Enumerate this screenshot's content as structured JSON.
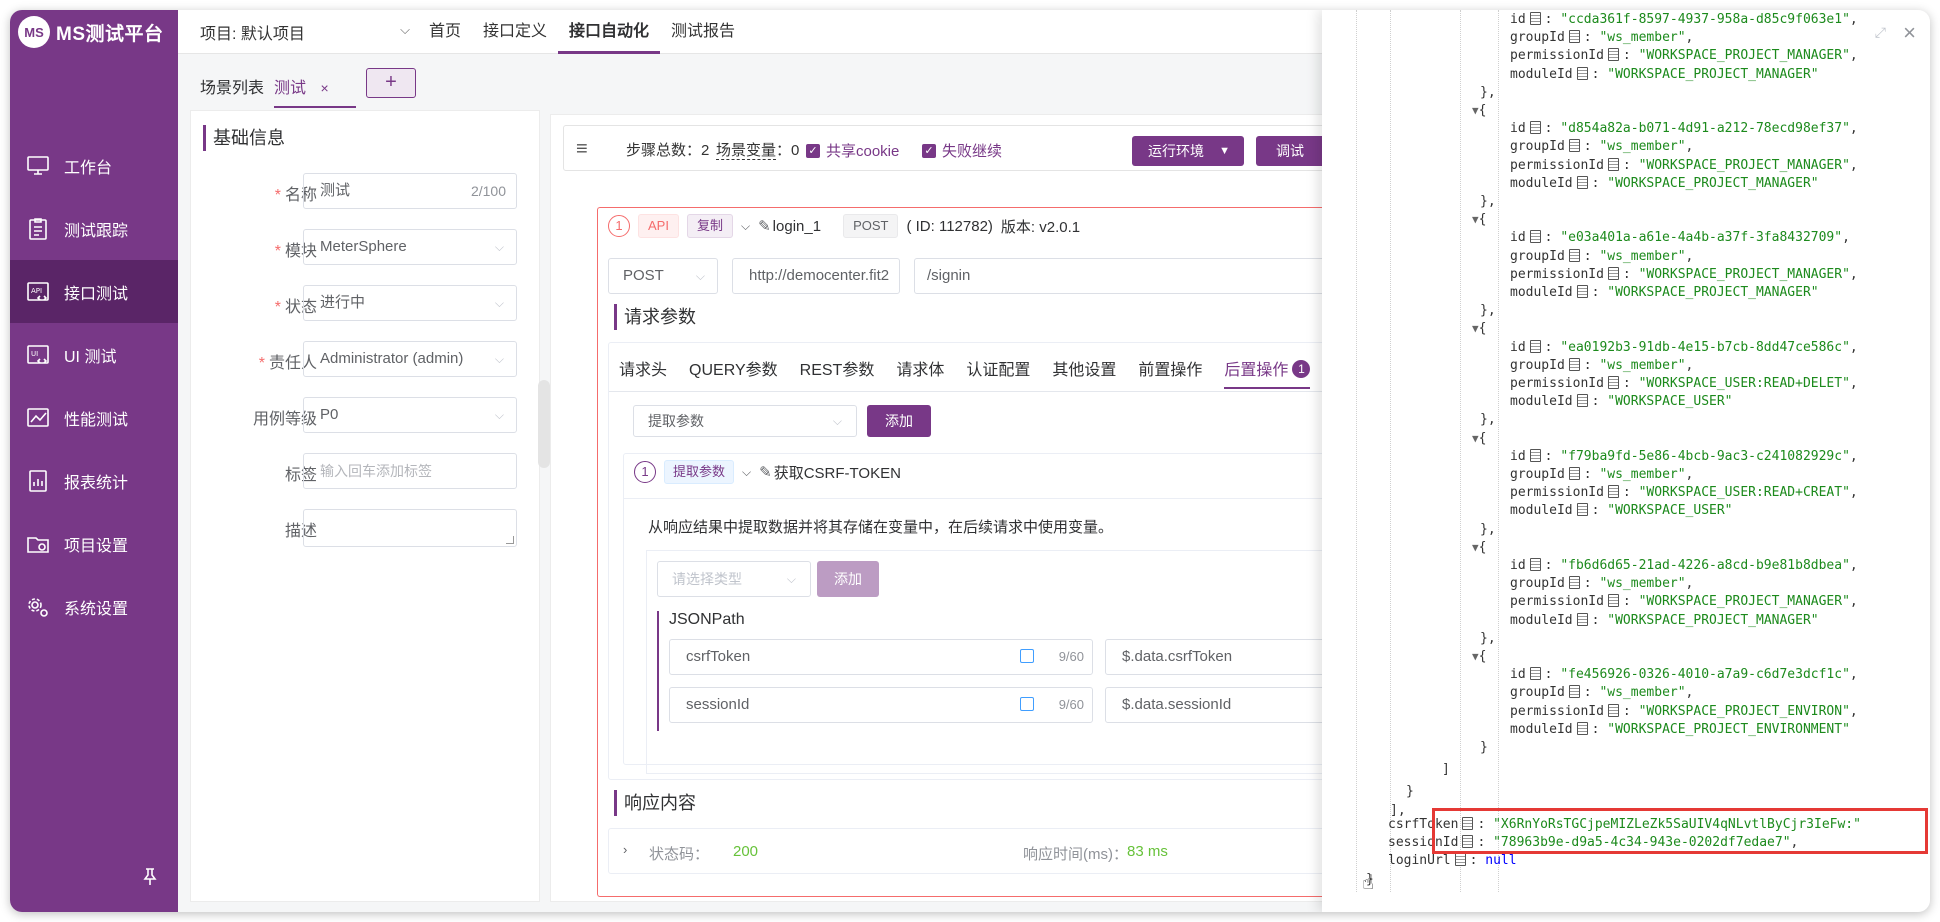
{
  "app": {
    "logo_mark": "MS",
    "logo_text": "MS测试平台"
  },
  "sidebar": {
    "items": [
      {
        "label": "工作台",
        "icon": "monitor-icon"
      },
      {
        "label": "测试跟踪",
        "icon": "clipboard-icon"
      },
      {
        "label": "接口测试",
        "icon": "api-icon"
      },
      {
        "label": "UI 测试",
        "icon": "ui-icon"
      },
      {
        "label": "性能测试",
        "icon": "performance-icon"
      },
      {
        "label": "报表统计",
        "icon": "report-icon"
      },
      {
        "label": "项目设置",
        "icon": "folder-icon"
      },
      {
        "label": "系统设置",
        "icon": "gear-icon"
      }
    ],
    "active_index": 2
  },
  "topbar": {
    "project": "项目: 默认项目",
    "menu": [
      "首页",
      "接口定义",
      "接口自动化",
      "测试报告"
    ],
    "active_menu_index": 2
  },
  "tabs": {
    "list_label": "场景列表",
    "active_label": "测试",
    "close": "×",
    "add": "+"
  },
  "form": {
    "title": "基础信息",
    "name_label": "名称",
    "name_value": "测试",
    "name_count": "2/100",
    "module_label": "模块",
    "module_value": "MeterSphere",
    "status_label": "状态",
    "status_value": "进行中",
    "owner_label": "责任人",
    "owner_value": "Administrator (admin)",
    "level_label": "用例等级",
    "level_value": "P0",
    "tag_label": "标签",
    "tag_placeholder": "输入回车添加标签",
    "desc_label": "描述",
    "required_mark": "*"
  },
  "toolbar": {
    "steps_text": "步骤总数：2",
    "vars_label": "场景变量",
    "vars_count": "：0",
    "share_cookie": "共享cookie",
    "continue_on_fail": "失败继续",
    "env_button": "运行环境",
    "debug_button": "调试"
  },
  "step": {
    "index": "1",
    "type_tag": "API",
    "copy_tag": "复制",
    "name": "login_1",
    "method_tag": "POST",
    "id_text": "( ID: 112782)",
    "version_text": "版本: v2.0.1",
    "method": "POST",
    "host": "http://democenter.fit2",
    "path": "/signin",
    "request_params_title": "请求参数",
    "request_tabs": [
      "请求头",
      "QUERY参数",
      "REST参数",
      "请求体",
      "认证配置",
      "其他设置",
      "前置操作",
      "后置操作"
    ],
    "active_request_tab": 7,
    "post_op_count": "1",
    "extract_select": "提取参数",
    "add_button": "添加",
    "extract": {
      "index": "1",
      "tag": "提取参数",
      "name": "获取CSRF-TOKEN",
      "description": "从响应结果中提取数据并将其存储在变量中，在后续请求中使用变量。",
      "type_placeholder": "请选择类型",
      "add_button": "添加",
      "jsonpath_title": "JSONPath",
      "rows": [
        {
          "name": "csrfToken",
          "count": "9/60",
          "expr": "$.data.csrfToken"
        },
        {
          "name": "sessionId",
          "count": "9/60",
          "expr": "$.data.sessionId"
        }
      ]
    },
    "response_title": "响应内容",
    "status_label": "状态码：",
    "status_value": "200",
    "time_label": "响应时间(ms)：",
    "time_value": "83 ms"
  },
  "json_drawer": {
    "close": "×",
    "expand": "⤢",
    "entries": [
      {
        "id": "ccda361f-8597-4937-958a-d85c9f063e1",
        "groupId": "ws_member",
        "permissionId": "WORKSPACE_PROJECT_MANAGER",
        "moduleId": "WORKSPACE_PROJECT_MANAGER"
      },
      {
        "id": "d854a82a-b071-4d91-a212-78ecd98ef37",
        "groupId": "ws_member",
        "permissionId": "WORKSPACE_PROJECT_MANAGER",
        "moduleId": "WORKSPACE_PROJECT_MANAGER"
      },
      {
        "id": "e03a401a-a61e-4a4b-a37f-3fa8432709",
        "groupId": "ws_member",
        "permissionId": "WORKSPACE_PROJECT_MANAGER",
        "moduleId": "WORKSPACE_PROJECT_MANAGER"
      },
      {
        "id": "ea0192b3-91db-4e15-b7cb-8dd47ce586c",
        "groupId": "ws_member",
        "permissionId": "WORKSPACE_USER:READ+DELET",
        "moduleId": "WORKSPACE_USER"
      },
      {
        "id": "f79ba9fd-5e86-4bcb-9ac3-c241082929c",
        "groupId": "ws_member",
        "permissionId": "WORKSPACE_USER:READ+CREAT",
        "moduleId": "WORKSPACE_USER"
      },
      {
        "id": "fb6d6d65-21ad-4226-a8cd-b9e81b8dbea",
        "groupId": "ws_member",
        "permissionId": "WORKSPACE_PROJECT_MANAGER",
        "moduleId": "WORKSPACE_PROJECT_MANAGER"
      },
      {
        "id": "fe456926-0326-4010-a7a9-c6d7e3dcf1c",
        "groupId": "ws_member",
        "permissionId": "WORKSPACE_PROJECT_ENVIRON",
        "moduleId": "WORKSPACE_PROJECT_ENVIRONMENT"
      }
    ],
    "csrfToken": "X6RnYoRsTGCjpeMIZLeZk5SaUIV4qNLvtlByCjr3IeFw:",
    "sessionId": "78963b9e-d9a5-4c34-943e-0202df7edae7",
    "loginUrl": "null"
  }
}
